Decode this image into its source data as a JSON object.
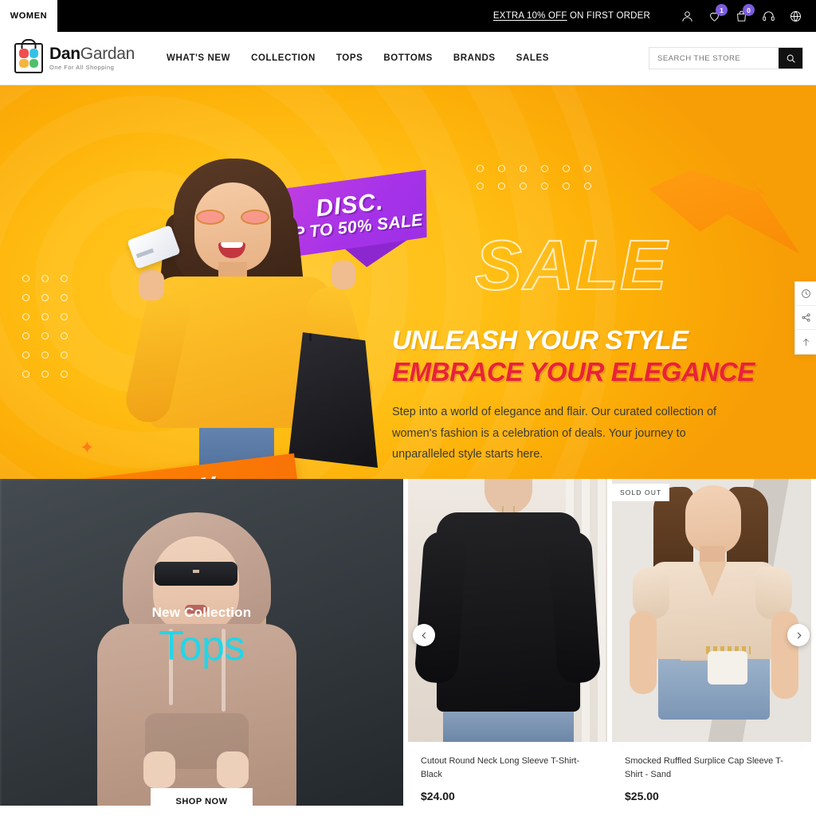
{
  "topbar": {
    "women_tab": "WOMEN",
    "promo_highlight": "EXTRA 10% OFF",
    "promo_rest": " ON FIRST ORDER",
    "icons": {
      "account": "user-icon",
      "wishlist": "heart-icon",
      "cart": "bag-icon",
      "support": "headset-icon",
      "language": "globe-icon"
    },
    "wishlist_count": "1",
    "cart_count": "0"
  },
  "header": {
    "logo_bold": "Dan",
    "logo_light": "Gardan",
    "logo_tagline": "One For All Shopping",
    "nav": [
      {
        "label": "WHAT'S NEW"
      },
      {
        "label": "COLLECTION"
      },
      {
        "label": "TOPS"
      },
      {
        "label": "BOTTOMS"
      },
      {
        "label": "BRANDS"
      },
      {
        "label": "SALES"
      }
    ]
  },
  "search": {
    "placeholder": "SEARCH THE STORE",
    "value": "",
    "icon": "search-icon"
  },
  "hero": {
    "disc_line1": "DISC.",
    "disc_line2": "UP TO 50% SALE",
    "ghost_text": "SALE",
    "headline_white": "UNLEASH YOUR STYLE",
    "headline_red": "EMBRACE YOUR ELEGANCE",
    "paragraph": "Step into a world of elegance and flair. Our curated collection of women's fashion is a celebration of deals. Your journey to unparalleled style starts here.",
    "cta": "SHOP NOW",
    "accent_yellow": "#ffbe13",
    "accent_red": "#e8223b",
    "accent_purple": "#a733e8",
    "accent_orange": "#f97306"
  },
  "side_widget": {
    "items": [
      {
        "icon": "recently-viewed-clock-icon"
      },
      {
        "icon": "share-icon"
      },
      {
        "icon": "scroll-to-top-arrow-icon"
      }
    ]
  },
  "collection_card": {
    "subtitle": "New Collection",
    "title": "Tops",
    "title_color": "#22d6e8",
    "button_label": "SHOP NOW"
  },
  "carousel": {
    "prev_icon": "chevron-left-icon",
    "next_icon": "chevron-right-icon",
    "products": [
      {
        "title": "Cutout Round Neck Long Sleeve T-Shirt- Black",
        "price": "$24.00",
        "badge": ""
      },
      {
        "title": "Smocked Ruffled Surplice Cap Sleeve T-Shirt - Sand",
        "price": "$25.00",
        "badge": "SOLD OUT"
      }
    ]
  }
}
